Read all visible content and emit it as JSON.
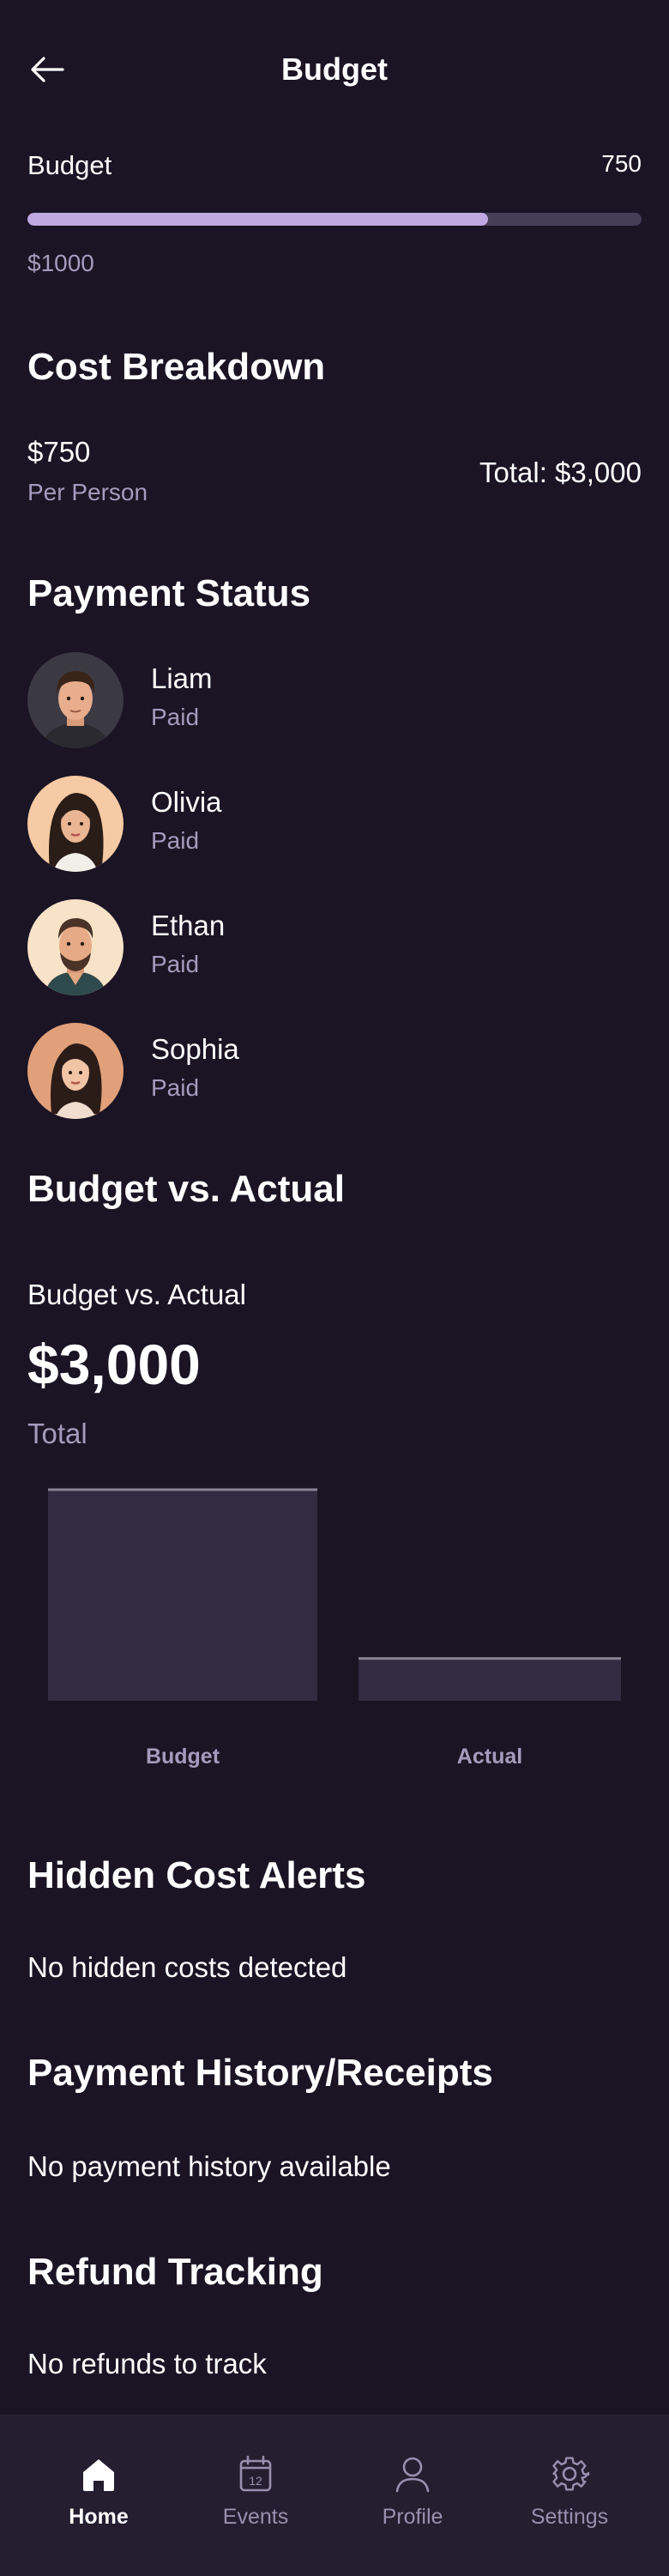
{
  "header": {
    "title": "Budget"
  },
  "budget": {
    "label": "Budget",
    "spent_display": "750",
    "max_display": "$1000",
    "progress": 0.75
  },
  "cost_breakdown": {
    "title": "Cost Breakdown",
    "per_person_amount": "$750",
    "per_person_label": "Per Person",
    "total": "Total: $3,000"
  },
  "payment_status": {
    "title": "Payment Status",
    "people": [
      {
        "name": "Liam",
        "status": "Paid"
      },
      {
        "name": "Olivia",
        "status": "Paid"
      },
      {
        "name": "Ethan",
        "status": "Paid"
      },
      {
        "name": "Sophia",
        "status": "Paid"
      }
    ]
  },
  "budget_vs_actual": {
    "title": "Budget vs. Actual",
    "subtitle": "Budget vs. Actual",
    "amount": "$3,000",
    "amount_label": "Total"
  },
  "chart_data": {
    "type": "bar",
    "categories": [
      "Budget",
      "Actual"
    ],
    "values": [
      1.0,
      0.2
    ],
    "title": "",
    "xlabel": "",
    "ylabel": "",
    "ylim": [
      0,
      1
    ],
    "grid": false
  },
  "hidden_costs": {
    "title": "Hidden Cost Alerts",
    "message": "No hidden costs detected"
  },
  "payment_history": {
    "title": "Payment History/Receipts",
    "message": "No payment history available"
  },
  "refunds": {
    "title": "Refund Tracking",
    "message": "No refunds to track"
  },
  "tabbar": {
    "items": [
      {
        "label": "Home",
        "icon": "home-icon",
        "active": true
      },
      {
        "label": "Events",
        "icon": "calendar-icon",
        "active": false,
        "badge": "12"
      },
      {
        "label": "Profile",
        "icon": "person-icon",
        "active": false
      },
      {
        "label": "Settings",
        "icon": "gear-icon",
        "active": false
      }
    ]
  },
  "colors": {
    "background": "#1a1424",
    "accent": "#c0a9e0",
    "track": "#463e59",
    "muted_text": "#a69bbd",
    "bar_fill": "#332b42",
    "tabbar": "#241e30"
  }
}
